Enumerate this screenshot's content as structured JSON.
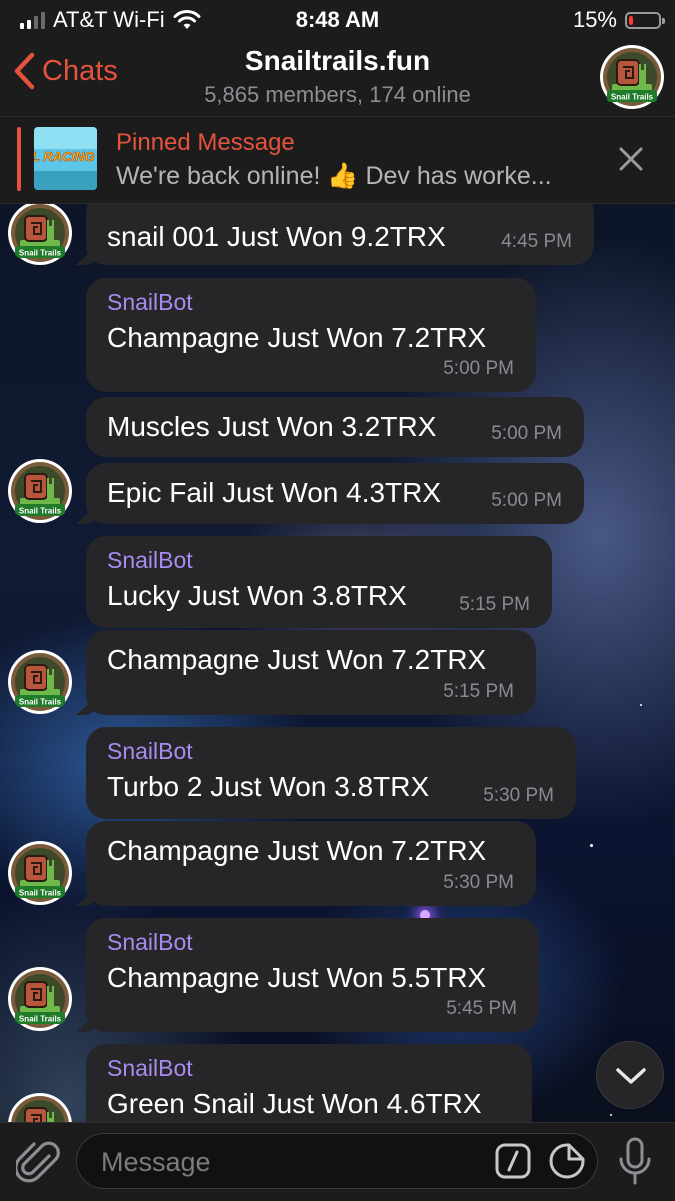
{
  "status_bar": {
    "carrier": "AT&T Wi-Fi",
    "time": "8:48 AM",
    "battery": "15%",
    "battery_level": 0.15,
    "battery_color": "#ff3b30"
  },
  "header": {
    "back_label": "Chats",
    "title": "Snailtrails.fun",
    "subtitle": "5,865 members, 174 online",
    "avatar_icon": "snail-trails-logo",
    "avatar_text": "Snail Trails"
  },
  "pinned": {
    "title": "Pinned Message",
    "text": "We're back online! 👍 Dev has worke...",
    "thumbnail_text": "L RACING"
  },
  "messages": [
    {
      "sender": "",
      "text": "snail 001 Just Won 9.2TRX",
      "time": "4:45 PM"
    },
    {
      "sender": "SnailBot",
      "text": "Champagne Just Won 7.2TRX",
      "time": "5:00 PM"
    },
    {
      "sender": "",
      "text": "Muscles Just Won 3.2TRX",
      "time": "5:00 PM"
    },
    {
      "sender": "",
      "text": "Epic Fail Just Won 4.3TRX",
      "time": "5:00 PM"
    },
    {
      "sender": "SnailBot",
      "text": "Lucky Just Won 3.8TRX",
      "time": "5:15 PM"
    },
    {
      "sender": "",
      "text": "Champagne Just Won 7.2TRX",
      "time": "5:15 PM"
    },
    {
      "sender": "SnailBot",
      "text": "Turbo 2 Just Won 3.8TRX",
      "time": "5:30 PM"
    },
    {
      "sender": "",
      "text": "Champagne Just Won 7.2TRX",
      "time": "5:30 PM"
    },
    {
      "sender": "SnailBot",
      "text": "Champagne Just Won 5.5TRX",
      "time": "5:45 PM"
    },
    {
      "sender": "SnailBot",
      "text": "Green Snail Just Won 4.6TRX",
      "time": ""
    }
  ],
  "input": {
    "placeholder": "Message"
  },
  "colors": {
    "accent": "#e5533d",
    "sender_name": "#a98bf0",
    "bubble": "#262628",
    "bar": "#1c1c1d"
  }
}
